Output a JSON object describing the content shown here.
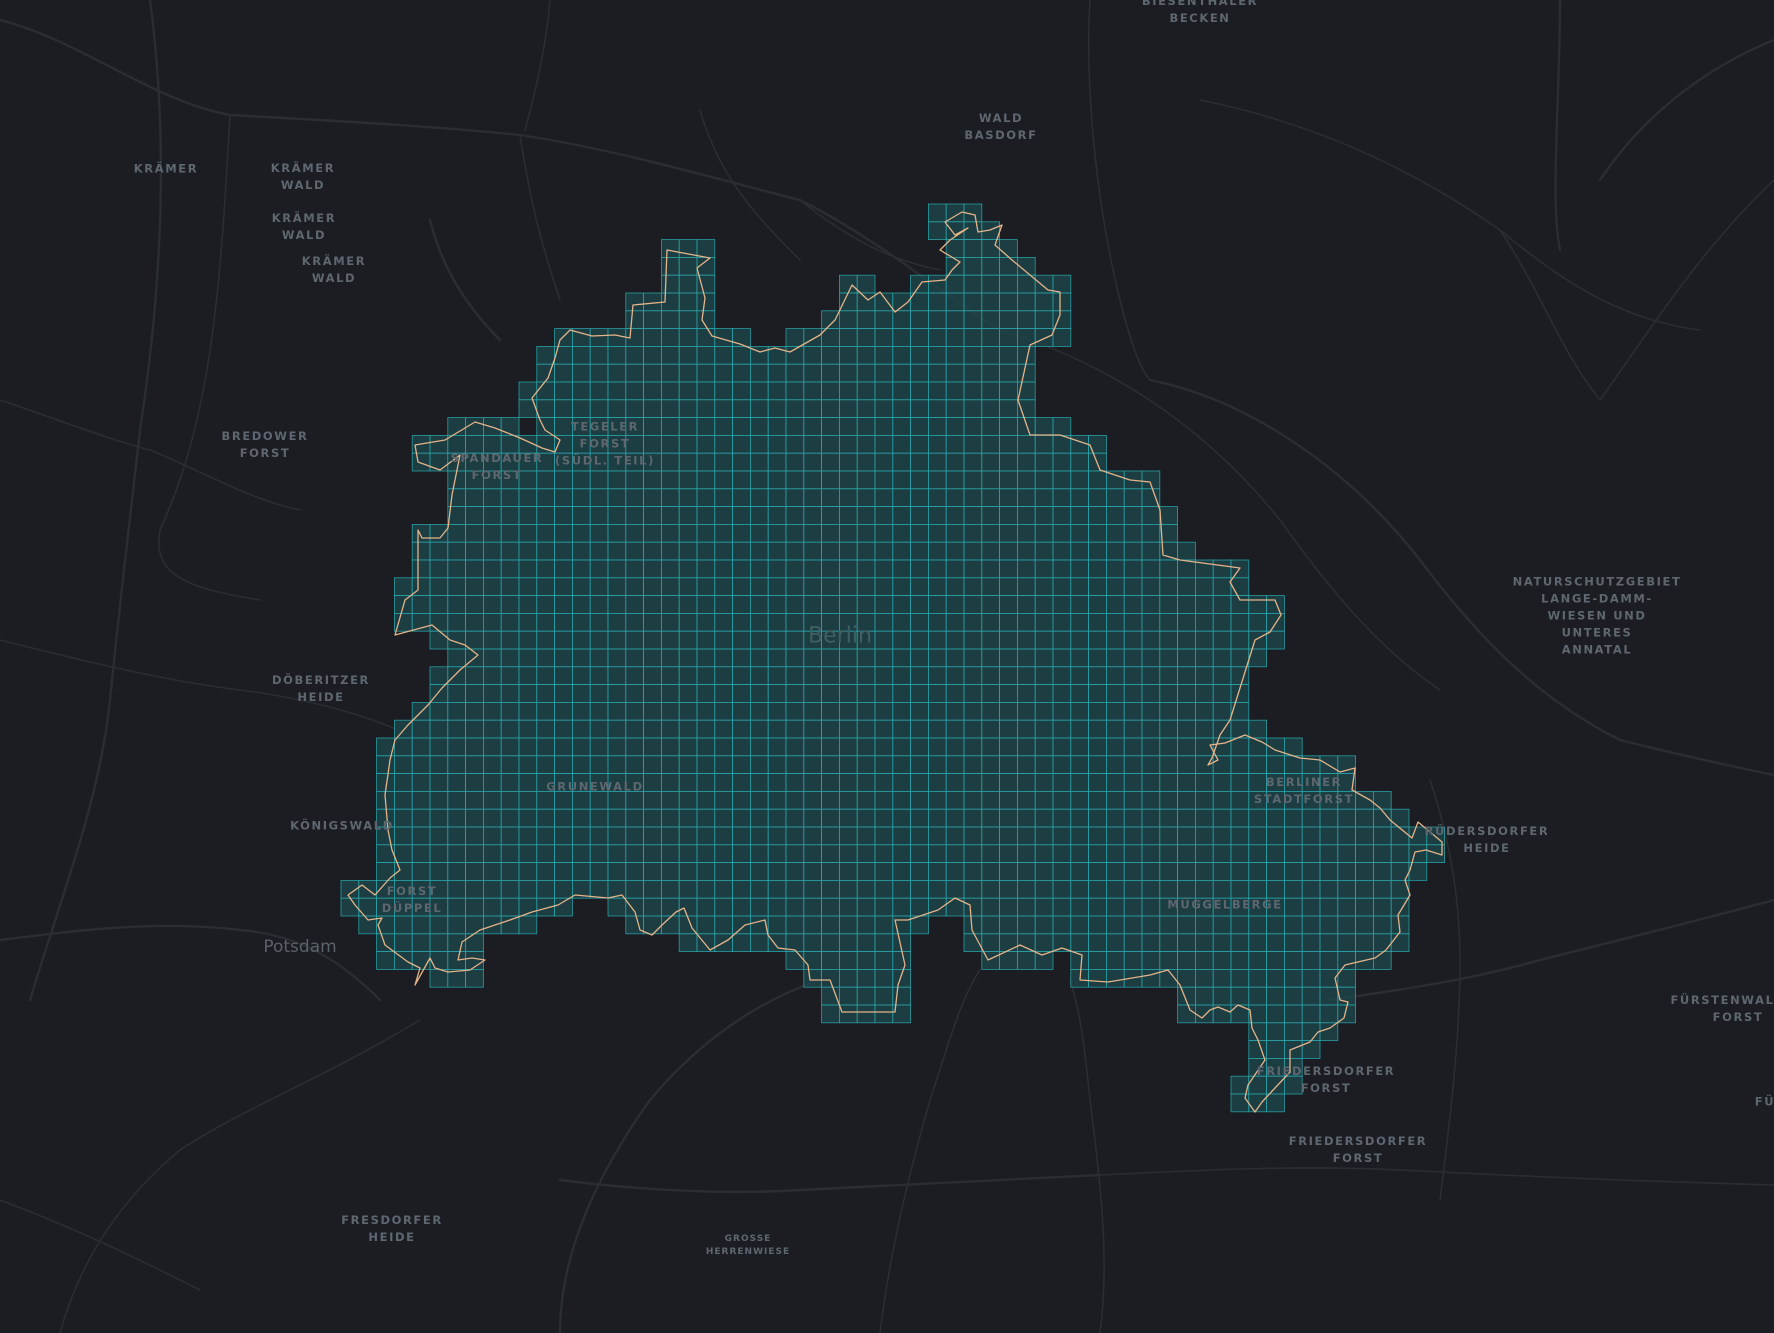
{
  "map": {
    "colors": {
      "background": "#1b1d22",
      "roads": "#2a2d32",
      "grid_fill": "#1d4a4e",
      "grid_line": "#2aa9ae",
      "boundary": "#e5b48a"
    },
    "city_labels": [
      {
        "id": "berlin",
        "text": "Berlin"
      },
      {
        "id": "potsdam",
        "text": "Potsdam"
      }
    ],
    "area_labels": [
      {
        "id": "biesenthaler-becken",
        "text": "BIESENTHALER\nBECKEN"
      },
      {
        "id": "wald-basdorf",
        "text": "WALD\nBASDORF"
      },
      {
        "id": "kraemer",
        "text": "KRÄMER"
      },
      {
        "id": "kraemer-wald-1",
        "text": "KRÄMER\nWALD"
      },
      {
        "id": "kraemer-wald-2",
        "text": "KRÄMER\nWALD"
      },
      {
        "id": "kraemer-wald-3",
        "text": "KRÄMER\nWALD"
      },
      {
        "id": "bredower-forst",
        "text": "BREDOWER\nFORST"
      },
      {
        "id": "spandauer-forst",
        "text": "SPANDAUER\nFORST"
      },
      {
        "id": "tegeler-forst",
        "text": "TEGELER\nFORST\n(SÜDL. TEIL)"
      },
      {
        "id": "doeberitzer-heide",
        "text": "DÖBERITZER\nHEIDE"
      },
      {
        "id": "grunewald",
        "text": "GRUNEWALD"
      },
      {
        "id": "koenigswald",
        "text": "KÖNIGSWALD"
      },
      {
        "id": "forst-dueppel",
        "text": "FORST\nDÜPPEL"
      },
      {
        "id": "naturschutzgebiet",
        "text": "NATURSCHUTZGEBIET\nLANGE-DAMM-\nWIESEN UND\nUNTERES\nANNATAL"
      },
      {
        "id": "berliner-stadtforst",
        "text": "BERLINER\nSTADTFORST"
      },
      {
        "id": "ruedersdorfer-heide",
        "text": "RÜDERSDORFER\nHEIDE"
      },
      {
        "id": "mueggelberge",
        "text": "MÜGGELBERGE"
      },
      {
        "id": "friedersdorfer-forst-1",
        "text": "FRIEDERSDORFER\nFORST"
      },
      {
        "id": "friedersdorfer-forst-2",
        "text": "FRIEDERSDORFER\nFORST"
      },
      {
        "id": "fuerstenwalder-forst",
        "text": "FÜRSTENWALDER\nFORST"
      },
      {
        "id": "fu-partial",
        "text": "FÜ"
      },
      {
        "id": "fresdorfer-heide",
        "text": "FRESDORFER\nHEIDE"
      },
      {
        "id": "grosse-herrenwiese",
        "text": "GROSSE\nHERRENWIESE"
      }
    ]
  }
}
